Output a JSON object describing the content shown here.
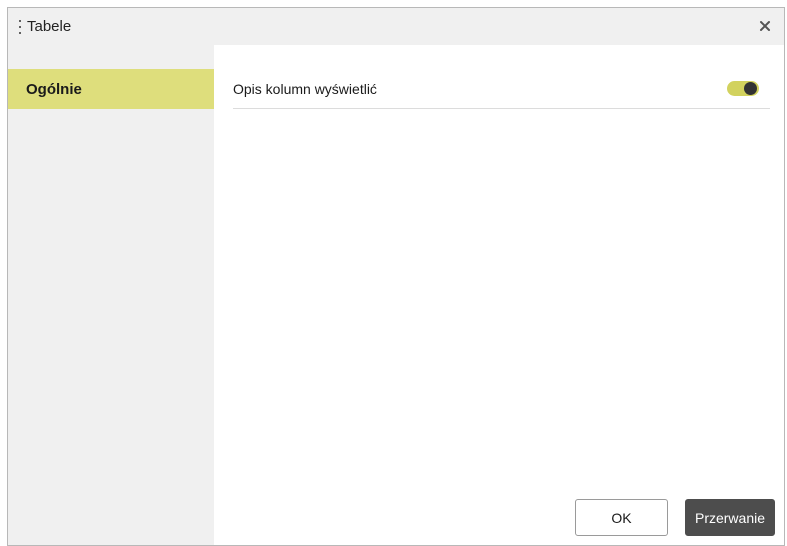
{
  "dialog": {
    "title": "Tabele",
    "close_icon": "close-icon",
    "drag_icon": "drag-handle-icon"
  },
  "sidebar": {
    "items": [
      {
        "label": "Ogólnie",
        "selected": true
      }
    ]
  },
  "settings": {
    "rows": [
      {
        "label": "Opis kolumn wyświetlić",
        "toggle_on": true
      }
    ]
  },
  "footer": {
    "ok_label": "OK",
    "cancel_label": "Przerwanie"
  },
  "colors": {
    "accent": "#dede7c",
    "toggle_track": "#d2d25e",
    "cancel_button": "#4d4d4d",
    "panel_background": "#f0f0f0"
  }
}
